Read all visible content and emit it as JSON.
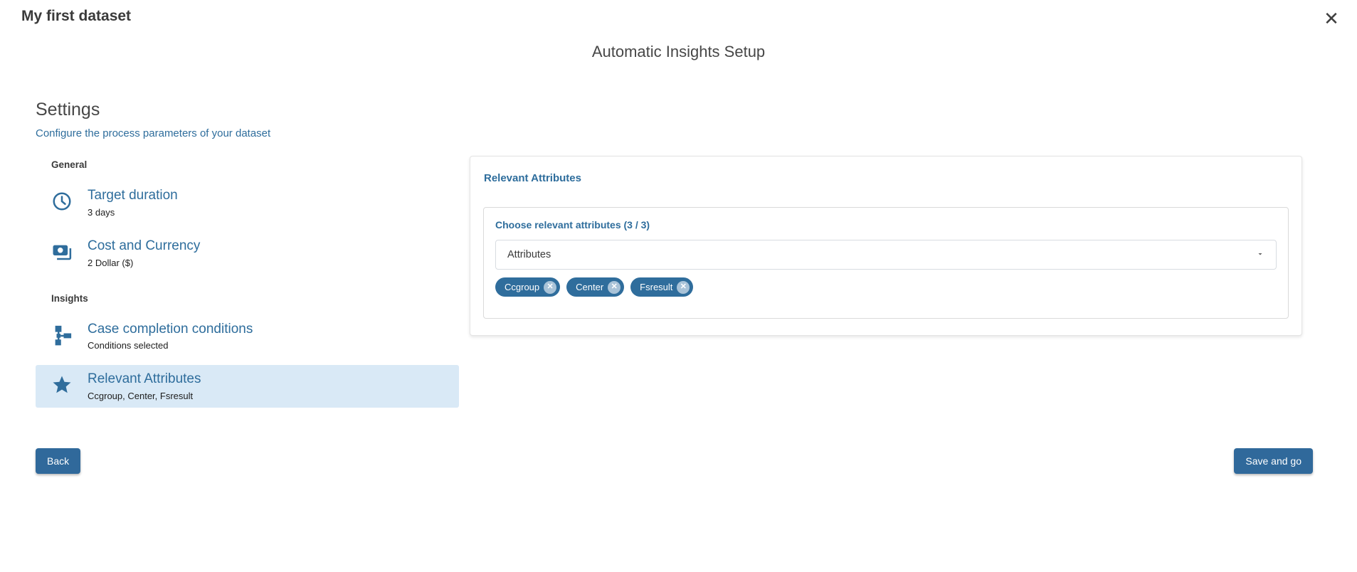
{
  "window": {
    "title": "My first dataset"
  },
  "icons": {
    "close": "✕",
    "chevron_down": "▼",
    "chip_remove": "✕"
  },
  "page": {
    "heading": "Automatic Insights Setup"
  },
  "settings": {
    "title": "Settings",
    "subtitle": "Configure the process parameters of your dataset"
  },
  "nav": {
    "groups": [
      {
        "label": "General",
        "items": [
          {
            "icon": "clock-icon",
            "title": "Target duration",
            "subtitle": "3 days",
            "selected": false
          },
          {
            "icon": "money-icon",
            "title": "Cost and Currency",
            "subtitle": "2 Dollar ($)",
            "selected": false
          }
        ]
      },
      {
        "label": "Insights",
        "items": [
          {
            "icon": "flow-icon",
            "title": "Case completion conditions",
            "subtitle": "Conditions selected",
            "selected": false
          },
          {
            "icon": "star-icon",
            "title": "Relevant Attributes",
            "subtitle": "Ccgroup, Center, Fsresult",
            "selected": true
          }
        ]
      }
    ]
  },
  "panel": {
    "title": "Relevant Attributes",
    "chooser_label": "Choose relevant attributes (3 / 3)",
    "dropdown_value": "Attributes",
    "chips": [
      "Ccgroup",
      "Center",
      "Fsresult"
    ]
  },
  "footer": {
    "back_label": "Back",
    "save_label": "Save and go"
  },
  "colors": {
    "primary": "#2e6d9c",
    "selected_bg": "#d9e9f6",
    "chip_bg": "#2f6d9c",
    "button_bg": "#30699b"
  }
}
